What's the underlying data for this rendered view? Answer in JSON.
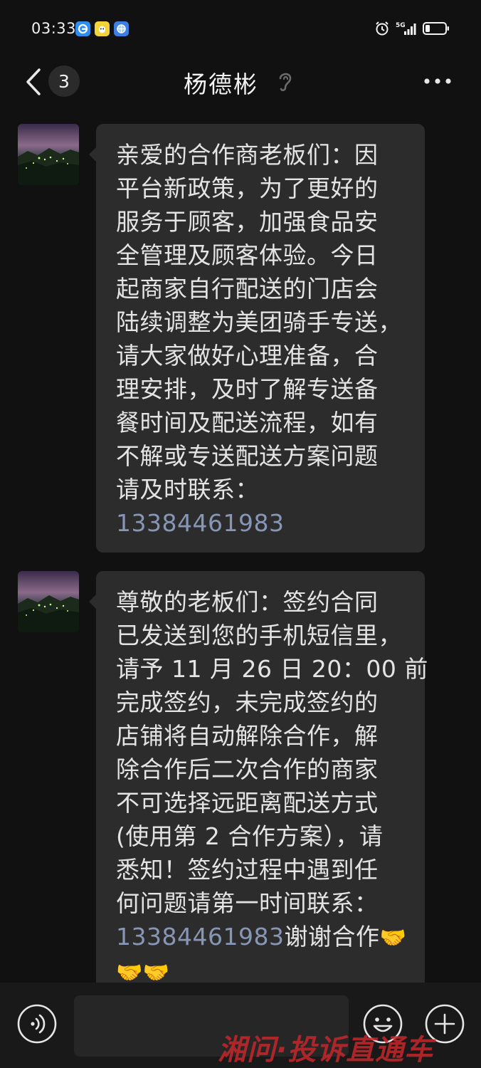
{
  "status_bar": {
    "time": "03:33",
    "network": "5G",
    "notification_icons": [
      "baidu-app-icon",
      "qq-music-icon",
      "browser-icon"
    ],
    "status_icons": [
      "alarm-icon",
      "signal-icon",
      "battery-icon"
    ]
  },
  "header": {
    "unread_count": "3",
    "title": "杨德彬",
    "icons": [
      "back-arrow-icon",
      "earpiece-icon",
      "more-dots-icon"
    ]
  },
  "messages": [
    {
      "sender": "other",
      "avatar": "night-landscape-avatar",
      "lines": [
        "亲爱的合作商老板们：因",
        "平台新政策，为了更好的",
        "服务于顾客，加强食品安",
        "全管理及顾客体验。今日",
        "起商家自行配送的门店会",
        "陆续调整为美团骑手专送，",
        "请大家做好心理准备，合",
        "理安排，及时了解专送备",
        "餐时间及配送流程，如有",
        "不解或专送配送方案问题",
        "请及时联系："
      ],
      "phone": "13384461983"
    },
    {
      "sender": "other",
      "avatar": "night-landscape-avatar",
      "lines": [
        "尊敬的老板们：签约合同",
        "已发送到您的手机短信里，",
        "请予 11 月 26 日 20：00 前",
        "完成签约，未完成签约的",
        "店铺将自动解除合作，解",
        "除合作后二次合作的商家",
        "不可选择远距离配送方式",
        "(使用第 2 合作方案），请",
        "悉知！签约过程中遇到任",
        "何问题请第一时间联系："
      ],
      "phone": "13384461983",
      "after_phone": "谢谢合作",
      "emoji": "🤝",
      "emoji_icon": "handshake-emoji"
    }
  ],
  "input_bar": {
    "message_value": "",
    "icons": [
      "voice-icon",
      "smiley-icon",
      "plus-icon"
    ]
  },
  "watermark": {
    "part_red": "湘问·投诉直通车",
    "color_red": "#c4262b",
    "color_blue": "#2f6fc4"
  },
  "colors": {
    "background": "#111111",
    "bubble": "#2c2c2c",
    "phone_link": "#8796b5"
  }
}
